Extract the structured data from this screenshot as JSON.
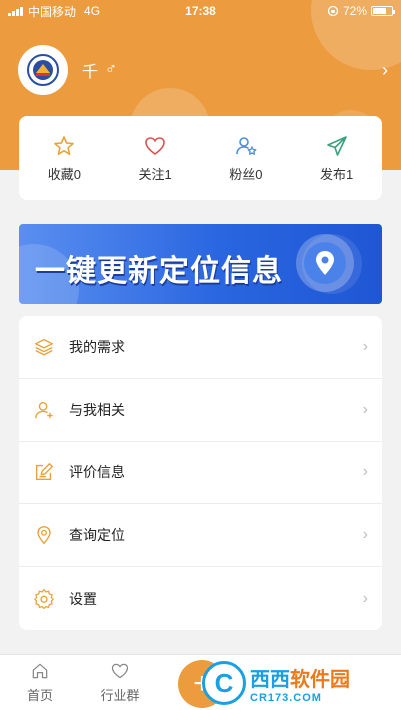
{
  "status_bar": {
    "carrier": "中国移动",
    "network": "4G",
    "time": "17:38",
    "battery": "72%",
    "battery_level": 0.72
  },
  "profile": {
    "name": "千",
    "gender_symbol": "♂",
    "arrow": "›"
  },
  "stats": [
    {
      "label": "收藏0",
      "icon": "star-icon",
      "color": "#e9a23b"
    },
    {
      "label": "关注1",
      "icon": "heart-icon",
      "color": "#d9534f"
    },
    {
      "label": "粉丝0",
      "icon": "fans-icon",
      "color": "#4a90e2"
    },
    {
      "label": "发布1",
      "icon": "paper-plane-icon",
      "color": "#3aa17e"
    }
  ],
  "banner": {
    "text": "一键更新定位信息",
    "icon": "location-pin-icon"
  },
  "menu": [
    {
      "label": "我的需求",
      "icon": "layers-icon"
    },
    {
      "label": "与我相关",
      "icon": "user-add-icon"
    },
    {
      "label": "评价信息",
      "icon": "edit-icon"
    },
    {
      "label": "查询定位",
      "icon": "location-icon"
    },
    {
      "label": "设置",
      "icon": "gear-icon"
    }
  ],
  "menu_arrow": "›",
  "tabbar": [
    {
      "label": "首页",
      "icon": "home-icon"
    },
    {
      "label": "行业群",
      "icon": "heart-outline-icon"
    }
  ],
  "tab_add": "+",
  "watermark": {
    "logo": "C",
    "main_a": "西西",
    "main_b": "软件园",
    "sub": "CR173.COM"
  },
  "colors": {
    "accent": "#ec9c3f",
    "banner_blue": "#2a66e0",
    "icon_orange": "#e9a23b"
  }
}
